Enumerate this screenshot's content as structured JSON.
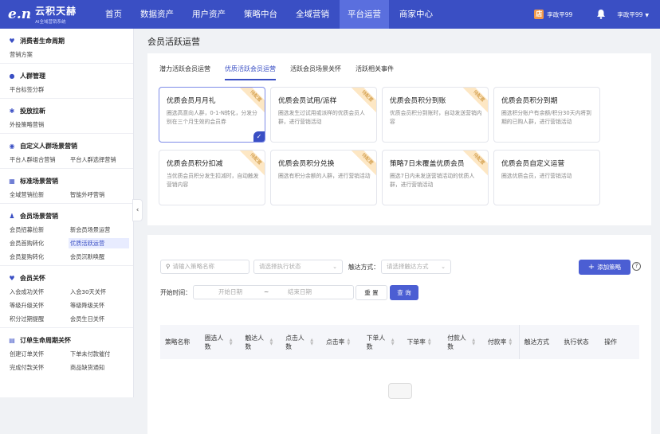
{
  "brand": {
    "mark": "e.n",
    "name": "云积天赫",
    "slogan": "AI全域营销系统"
  },
  "nav": {
    "items": [
      "首页",
      "数据资产",
      "用户资产",
      "策略中台",
      "全域营销",
      "平台运营",
      "商家中心"
    ],
    "active": "平台运营"
  },
  "header_right": {
    "store_icon": "店",
    "store": "李政平99",
    "user": "李政平99",
    "caret": "▼"
  },
  "sidebar": [
    {
      "title": "消费者生命周期",
      "icon": "heart-icon",
      "glyph": "♥",
      "items": [
        "营销方案"
      ]
    },
    {
      "title": "人群管理",
      "icon": "user-icon",
      "glyph": "●",
      "items": [
        "平台标签分群"
      ]
    },
    {
      "title": "投放拉新",
      "icon": "gear-icon",
      "glyph": "✱",
      "items": [
        "外投策略营销"
      ]
    },
    {
      "title": "自定义人群场景营销",
      "icon": "target-icon",
      "glyph": "◉",
      "items": [
        "平台人群组合营销",
        "平台人群选择营销"
      ]
    },
    {
      "title": "标准场景营销",
      "icon": "grid-icon",
      "glyph": "▦",
      "items": [
        "全域营销拉新",
        "智能外呼营销"
      ]
    },
    {
      "title": "会员场景营销",
      "icon": "member-icon",
      "glyph": "♟",
      "items": [
        "会员招募拉新",
        "新会员场景运营",
        "会员首购转化",
        "优质活跃运营",
        "会员复购转化",
        "会员沉默唤醒"
      ]
    },
    {
      "title": "会员关怀",
      "icon": "care-icon",
      "glyph": "♥",
      "items": [
        "入会成功关怀",
        "入会30天关怀",
        "等级升级关怀",
        "等级降级关怀",
        "积分过期提醒",
        "会员生日关怀"
      ]
    },
    {
      "title": "订单生命周期关怀",
      "icon": "order-icon",
      "glyph": "▤",
      "items": [
        "创建订单关怀",
        "下单未付款催付",
        "完成付款关怀",
        "商品缺货通知"
      ]
    }
  ],
  "sidebar_active": "优质活跃运营",
  "page_title": "会员活跃运营",
  "tabs": [
    "潜力活跃会员运营",
    "优质活跃会员运营",
    "活跃会员场景关怀",
    "活跃相关事件"
  ],
  "tab_active": "优质活跃会员运营",
  "ribbon_text": "待配置",
  "tiles": [
    {
      "title": "优质会员月月礼",
      "desc": "圈选高意向人群，0-1-N转化，分发分别在三个月生效的会员券",
      "ribbon": true,
      "selected": true
    },
    {
      "title": "优质会员试用/派样",
      "desc": "圈选发生过试用或派样的优质会员人群，进行营销活动",
      "ribbon": true,
      "selected": false
    },
    {
      "title": "优质会员积分到账",
      "desc": "优质会员积分到账时，自动发送营销内容",
      "ribbon": true,
      "selected": false
    },
    {
      "title": "优质会员积分到期",
      "desc": "圈选积分账户有余额/积分30天内将到期的已购人群，进行营销活动",
      "ribbon": false,
      "selected": false
    },
    {
      "title": "优质会员积分扣减",
      "desc": "当优质会员积分发生扣减时，自动触发营销内容",
      "ribbon": true,
      "selected": false
    },
    {
      "title": "优质会员积分兑换",
      "desc": "圈选有积分余额的人群，进行营销活动",
      "ribbon": true,
      "selected": false
    },
    {
      "title": "策略7日未覆盖优质会员",
      "desc": "圈选7日内未发送营销活动的优质人群，进行营销活动",
      "ribbon": true,
      "selected": false
    },
    {
      "title": "优质会员自定义运营",
      "desc": "圈选优质会员，进行营销活动",
      "ribbon": false,
      "selected": false
    }
  ],
  "filters": {
    "search_placeholder": "请输入策略名称",
    "status_placeholder": "请选择执行状态",
    "channel_label": "触达方式：",
    "channel_placeholder": "请选择触达方式",
    "add_button": "添加策略",
    "start_label": "开始时间：",
    "start_placeholder": "开始日期",
    "range_sep": "~",
    "end_placeholder": "结束日期",
    "reset": "重 置",
    "query": "查 询"
  },
  "table_headers": [
    {
      "label": "策略名称",
      "sortable": false
    },
    {
      "label": "圈选人数",
      "sortable": true
    },
    {
      "label": "触达人数",
      "sortable": true
    },
    {
      "label": "点击人数",
      "sortable": true
    },
    {
      "label": "点击率",
      "sortable": true
    },
    {
      "label": "下单人数",
      "sortable": true
    },
    {
      "label": "下单率",
      "sortable": true
    },
    {
      "label": "付款人数",
      "sortable": true
    },
    {
      "label": "付款率",
      "sortable": true
    },
    {
      "label": "触达方式",
      "sortable": false
    },
    {
      "label": "执行状态",
      "sortable": false
    },
    {
      "label": "操作",
      "sortable": false
    }
  ],
  "colors": {
    "primary": "#3a4fc4",
    "button": "#4b5ed3",
    "ribbon_bg": "#fde7c4",
    "ribbon_text": "#c78a2a"
  }
}
